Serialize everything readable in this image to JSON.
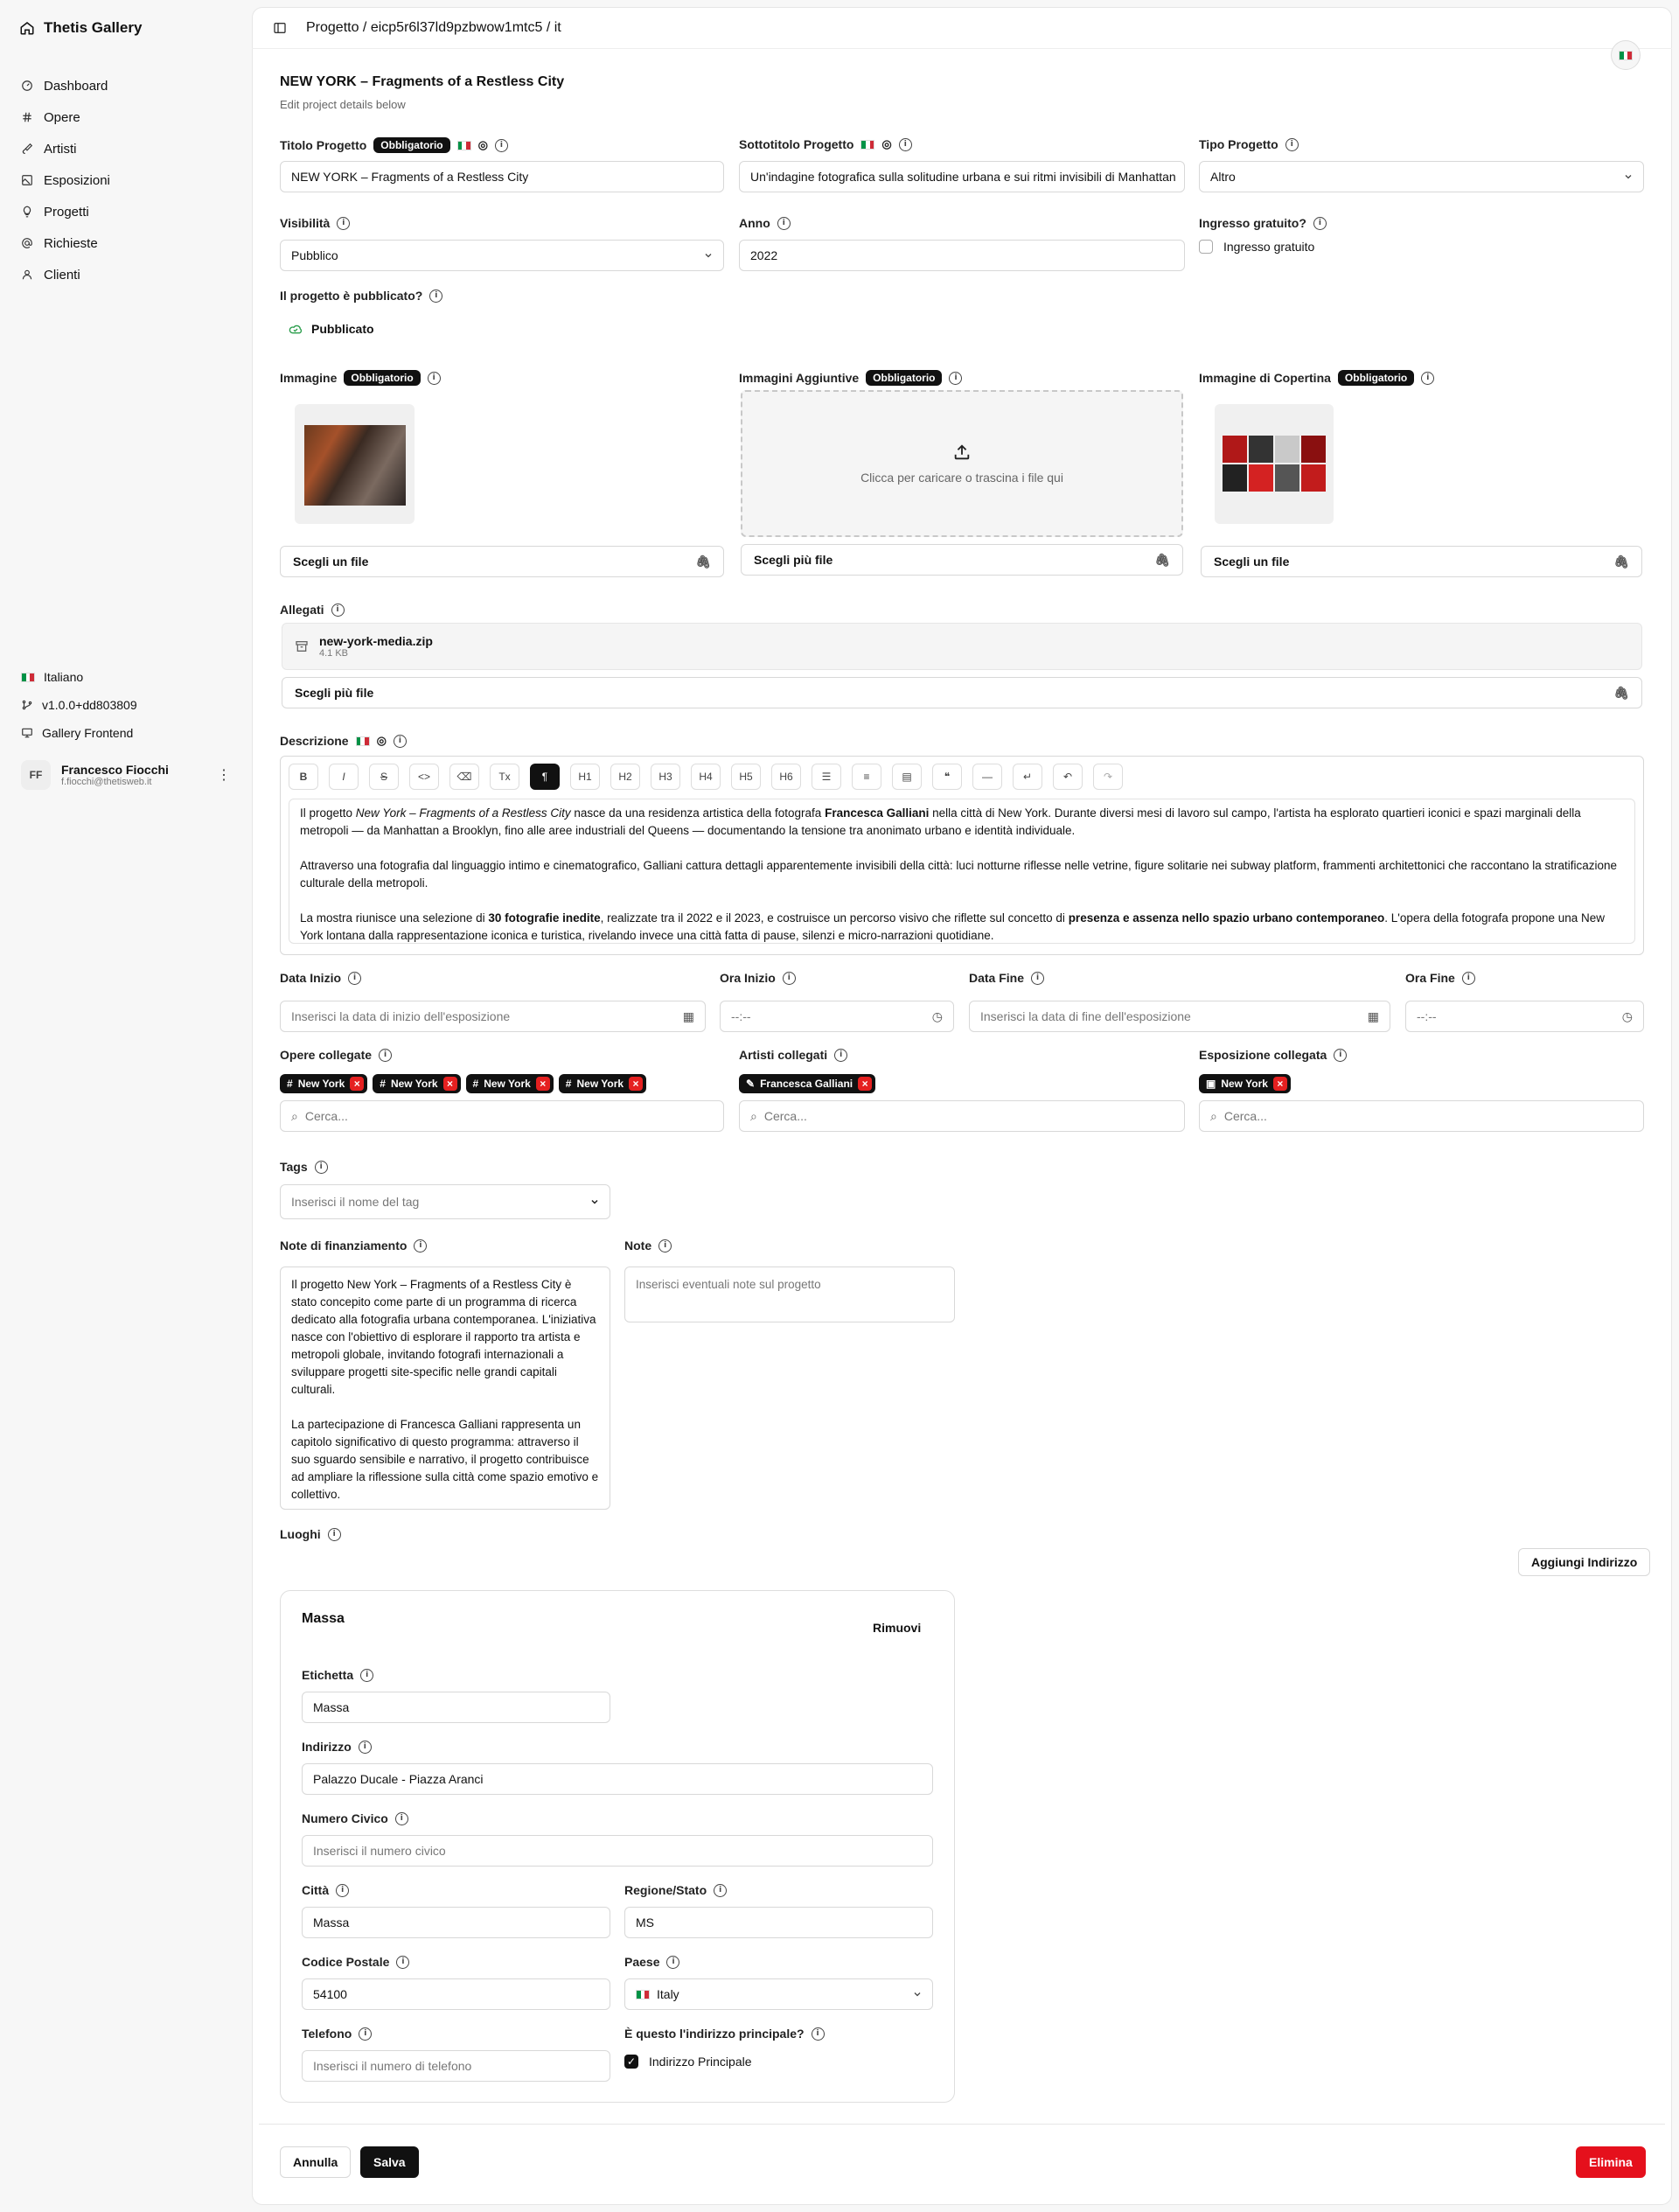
{
  "app": {
    "name": "Thetis Gallery"
  },
  "sidebar": {
    "items": [
      {
        "label": "Dashboard"
      },
      {
        "label": "Opere"
      },
      {
        "label": "Artisti"
      },
      {
        "label": "Esposizioni"
      },
      {
        "label": "Progetti"
      },
      {
        "label": "Richieste"
      },
      {
        "label": "Clienti"
      }
    ],
    "language": "Italiano",
    "version": "v1.0.0+dd803809",
    "frontend": "Gallery Frontend"
  },
  "user": {
    "initials": "FF",
    "name": "Francesco Fiocchi",
    "email": "f.fiocchi@thetisweb.it"
  },
  "header": {
    "breadcrumb": "Progetto / eicp5r6l37ld9pzbwow1mtc5 / it"
  },
  "page": {
    "title": "NEW YORK – Fragments of a Restless City",
    "subtitle": "Edit project details below"
  },
  "required": "Obbligatorio",
  "fields": {
    "titolo": {
      "label": "Titolo Progetto",
      "value": "NEW YORK – Fragments of a Restless City"
    },
    "sottotitolo": {
      "label": "Sottotitolo Progetto",
      "value": "Un'indagine fotografica sulla solitudine urbana e sui ritmi invisibili di Manhattan"
    },
    "tipo": {
      "label": "Tipo Progetto",
      "value": "Altro"
    },
    "visibilita": {
      "label": "Visibilità",
      "value": "Pubblico"
    },
    "anno": {
      "label": "Anno",
      "value": "2022"
    },
    "ingresso": {
      "label": "Ingresso gratuito?",
      "checkbox": "Ingresso gratuito"
    },
    "pubblicato": {
      "label": "Il progetto è pubblicato?",
      "value": "Pubblicato"
    },
    "immagine": {
      "label": "Immagine",
      "button": "Scegli un file"
    },
    "aggiuntive": {
      "label": "Immagini Aggiuntive",
      "upload": "Clicca per caricare o trascina i file qui",
      "button": "Scegli più file"
    },
    "copertina": {
      "label": "Immagine di Copertina",
      "button": "Scegli un file"
    },
    "allegati": {
      "label": "Allegati",
      "file_name": "new-york-media.zip",
      "file_size": "4.1 KB",
      "button": "Scegli più file"
    },
    "descrizione": {
      "label": "Descrizione"
    },
    "data_inizio": {
      "label": "Data Inizio",
      "placeholder": "Inserisci la data di inizio dell'esposizione"
    },
    "ora_inizio": {
      "label": "Ora Inizio",
      "placeholder": "--:--"
    },
    "data_fine": {
      "label": "Data Fine",
      "placeholder": "Inserisci la data di fine dell'esposizione"
    },
    "ora_fine": {
      "label": "Ora Fine",
      "placeholder": "--:--"
    },
    "opere": {
      "label": "Opere collegate",
      "chips": [
        "New York",
        "New York",
        "New York",
        "New York"
      ],
      "placeholder": "Cerca..."
    },
    "artisti": {
      "label": "Artisti collegati",
      "chips": [
        "Francesca Galliani"
      ],
      "placeholder": "Cerca..."
    },
    "esposizione": {
      "label": "Esposizione collegata",
      "chips": [
        "New York"
      ],
      "placeholder": "Cerca..."
    },
    "tags": {
      "label": "Tags",
      "placeholder": "Inserisci il nome del tag"
    },
    "finanziamento": {
      "label": "Note di finanziamento",
      "value": "Il progetto New York – Fragments of a Restless City è stato concepito come parte di un programma di ricerca dedicato alla fotografia urbana contemporanea. L'iniziativa nasce con l'obiettivo di esplorare il rapporto tra artista e metropoli globale, invitando fotografi internazionali a sviluppare progetti site-specific nelle grandi capitali culturali.\n\nLa partecipazione di Francesca Galliani rappresenta un capitolo significativo di questo programma: attraverso il suo sguardo sensibile e narrativo, il progetto contribuisce ad ampliare la riflessione sulla città come spazio emotivo e collettivo."
    },
    "note": {
      "label": "Note",
      "placeholder": "Inserisci eventuali note sul progetto"
    },
    "luoghi": {
      "label": "Luoghi",
      "add_button": "Aggiungi Indirizzo"
    }
  },
  "description": {
    "p1": {
      "a": "Il progetto ",
      "b": "New York – Fragments of a Restless City",
      "c": " nasce da una residenza artistica della fotografa ",
      "d": "Francesca Galliani",
      "e": " nella città di New York. Durante diversi mesi di lavoro sul campo, l'artista ha esplorato quartieri iconici e spazi marginali della metropoli — da Manhattan a Brooklyn, fino alle aree industriali del Queens — documentando la tensione tra anonimato urbano e identità individuale."
    },
    "p2": "Attraverso una fotografia dal linguaggio intimo e cinematografico, Galliani cattura dettagli apparentemente invisibili della città: luci notturne riflesse nelle vetrine, figure solitarie nei subway platform, frammenti architettonici che raccontano la stratificazione culturale della metropoli.",
    "p3": {
      "a": "La mostra riunisce una selezione di ",
      "b": "30 fotografie inedite",
      "c": ", realizzate tra il 2022 e il 2023, e costruisce un percorso visivo che riflette sul concetto di ",
      "d": "presenza e assenza nello spazio urbano contemporaneo",
      "e": ". L'opera della fotografa propone una New York lontana dalla rappresentazione iconica e turistica, rivelando invece una città fatta di pause, silenzi e micro-narrazioni quotidiane."
    }
  },
  "toolbar": [
    "B",
    "I",
    "S",
    "<>",
    "eraser",
    "Tx",
    "¶",
    "H1",
    "H2",
    "H3",
    "H4",
    "H5",
    "H6",
    "ul",
    "ol",
    "code-block",
    "quote",
    "—",
    "↵",
    "undo",
    "redo"
  ],
  "address": {
    "title": "Massa",
    "remove": "Rimuovi",
    "etichetta": {
      "label": "Etichetta",
      "value": "Massa"
    },
    "indirizzo": {
      "label": "Indirizzo",
      "value": "Palazzo Ducale - Piazza Aranci"
    },
    "civico": {
      "label": "Numero Civico",
      "placeholder": "Inserisci il numero civico"
    },
    "citta": {
      "label": "Città",
      "value": "Massa"
    },
    "regione": {
      "label": "Regione/Stato",
      "value": "MS"
    },
    "cap": {
      "label": "Codice Postale",
      "value": "54100"
    },
    "paese": {
      "label": "Paese",
      "value": "Italy"
    },
    "telefono": {
      "label": "Telefono",
      "placeholder": "Inserisci il numero di telefono"
    },
    "principale": {
      "label": "È questo l'indirizzo principale?",
      "checkbox": "Indirizzo Principale"
    }
  },
  "footer": {
    "cancel": "Annulla",
    "save": "Salva",
    "delete": "Elimina"
  },
  "colors": {
    "accent": "#111111",
    "danger": "#e5101c"
  }
}
